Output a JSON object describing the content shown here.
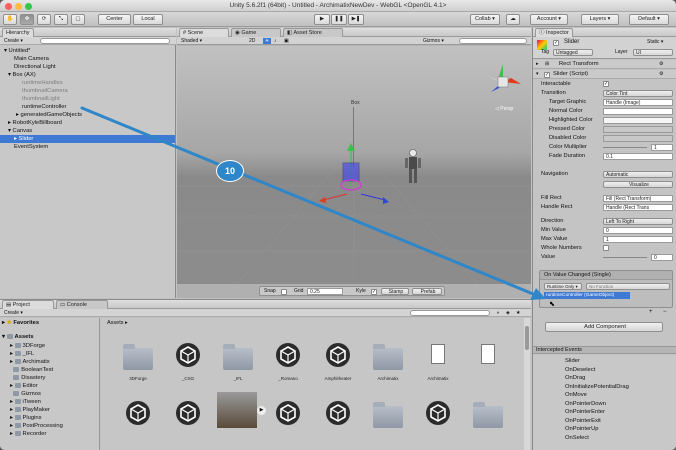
{
  "window": {
    "title": "Unity 5.6.2f1 (64bit) - Untitled - ArchimatixNewDev - WebGL <OpenGL 4.1>"
  },
  "toolbar": {
    "center": "Center",
    "local": "Local",
    "collab": "Collab ▾",
    "account": "Account ▾",
    "layers": "Layers ▾",
    "layout": "Default ▾"
  },
  "hierarchy": {
    "tab": "Hierarchy",
    "create": "Create ▾",
    "search_placeholder": "",
    "items": [
      {
        "label": "Untitled*"
      },
      {
        "label": "Main Camera"
      },
      {
        "label": "Directional Light"
      },
      {
        "label": "Box (AX)"
      },
      {
        "label": "runtimeHandles"
      },
      {
        "label": "thumbnailCamera"
      },
      {
        "label": "thumbnailLight"
      },
      {
        "label": "runtimeController"
      },
      {
        "label": "generatedGameObjects"
      },
      {
        "label": "RobotKyleBillboard"
      },
      {
        "label": "Canvas"
      },
      {
        "label": "Slider"
      },
      {
        "label": "EventSystem"
      }
    ]
  },
  "scene": {
    "tabs": [
      "Scene",
      "Game",
      "Asset Store"
    ],
    "shaded": "Shaded ▾",
    "mode2d": "2D",
    "gizmos": "Gizmos ▾",
    "box_label": "Box",
    "persp": "◁ Persp",
    "step_badge": "10",
    "snap": "Snap",
    "grid": "Grid",
    "grid_value": "0.25",
    "kyle": "Kyle",
    "stamp": "Stamp",
    "prefab": "Prefab"
  },
  "inspector": {
    "tab": "Inspector",
    "object_name": "Slider",
    "static": "Static ▾",
    "tag_label": "Tag",
    "tag_value": "Untagged",
    "layer_label": "Layer",
    "layer_value": "UI",
    "rect_transform": "Rect Transform",
    "component": "Slider (Script)",
    "rows": [
      {
        "label": "Interactable",
        "value": "✓"
      },
      {
        "label": "Transition",
        "value": "Color Tint"
      },
      {
        "label": "Target Graphic",
        "value": "Handle (Image)"
      },
      {
        "label": "Normal Color",
        "value": ""
      },
      {
        "label": "Highlighted Color",
        "value": ""
      },
      {
        "label": "Pressed Color",
        "value": ""
      },
      {
        "label": "Disabled Color",
        "value": ""
      },
      {
        "label": "Color Multiplier",
        "value": "1"
      },
      {
        "label": "Fade Duration",
        "value": "0.1"
      }
    ],
    "navigation_label": "Navigation",
    "navigation_value": "Automatic",
    "visualize": "Visualize",
    "rows2": [
      {
        "label": "Fill Rect",
        "value": "Fill (Rect Transform)"
      },
      {
        "label": "Handle Rect",
        "value": "Handle (Rect Trans"
      }
    ],
    "rows3": [
      {
        "label": "Direction",
        "value": "Left To Right"
      },
      {
        "label": "Min Value",
        "value": "0"
      },
      {
        "label": "Max Value",
        "value": "1"
      },
      {
        "label": "Whole Numbers",
        "value": ""
      },
      {
        "label": "Value",
        "value": "0"
      }
    ],
    "event_title": "On Value Changed (Single)",
    "runtime_only": "Runtime Only ▾",
    "no_function": "No Function",
    "drag_target": "runtimeController (GameObject)",
    "add_component": "Add Component",
    "intercepted": "Intercepted Events",
    "events": [
      "Slider",
      "OnDeselect",
      "OnDrag",
      "OnInitializePotentialDrag",
      "OnMove",
      "OnPointerDown",
      "OnPointerEnter",
      "OnPointerExit",
      "OnPointerUp",
      "OnSelect"
    ]
  },
  "project": {
    "tabs": [
      "Project",
      "Console"
    ],
    "create": "Create ▾",
    "favorites": "Favorites",
    "assets_root": "Assets",
    "folders": [
      "3DForge",
      "_IFL",
      "Archimatix",
      "BooleanTest",
      "Disastery",
      "Editor",
      "Gizmos",
      "iTween",
      "PlayMaker",
      "Plugins",
      "PostProcessing",
      "Recorder"
    ],
    "breadcrumb": "Assets ▸",
    "grid": [
      {
        "label": "3DForge",
        "kind": "folder"
      },
      {
        "label": "_CSG",
        "kind": "unity"
      },
      {
        "label": "_IFL",
        "kind": "folder"
      },
      {
        "label": "_Romano",
        "kind": "unity"
      },
      {
        "label": "Amphitheater",
        "kind": "unity"
      },
      {
        "label": "Archimatix",
        "kind": "folder"
      },
      {
        "label": "Archimatix",
        "kind": "doc"
      },
      {
        "label": "",
        "kind": "doc"
      },
      {
        "label": "",
        "kind": "unity"
      },
      {
        "label": "",
        "kind": "unity"
      },
      {
        "label": "",
        "kind": "video"
      },
      {
        "label": "",
        "kind": "unity"
      },
      {
        "label": "",
        "kind": "unity"
      },
      {
        "label": "",
        "kind": "folder"
      },
      {
        "label": "",
        "kind": "unity"
      },
      {
        "label": "",
        "kind": "folder"
      }
    ]
  },
  "colors": {
    "accent": "#3e7ad3",
    "arrow": "#2f86c8",
    "scene_bg": "#8a8a8a"
  }
}
